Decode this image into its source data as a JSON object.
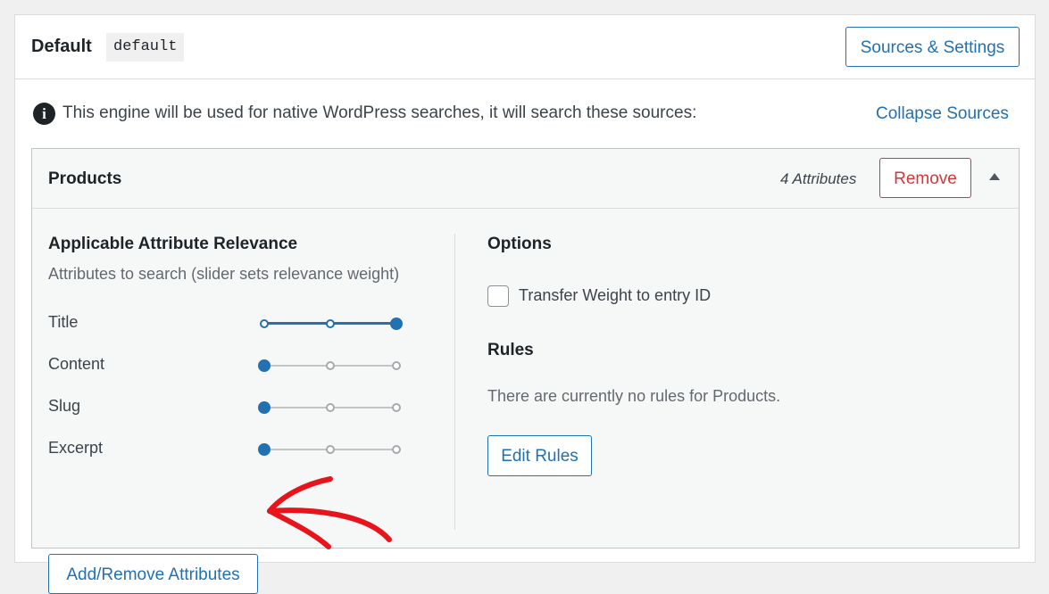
{
  "engine": {
    "title": "Default",
    "slug": "default",
    "sources_button": "Sources & Settings",
    "info_text": "This engine will be used for native WordPress searches, it will search these sources:",
    "collapse_link": "Collapse Sources"
  },
  "source": {
    "title": "Products",
    "attribute_count": "4 Attributes",
    "remove_button": "Remove",
    "relevance": {
      "heading": "Applicable Attribute Relevance",
      "subheading": "Attributes to search (slider sets relevance weight)",
      "attributes": [
        {
          "label": "Title",
          "weight": 3
        },
        {
          "label": "Content",
          "weight": 1
        },
        {
          "label": "Slug",
          "weight": 1
        },
        {
          "label": "Excerpt",
          "weight": 1
        }
      ],
      "weight_max": 3,
      "add_remove_button": "Add/Remove Attributes"
    },
    "options": {
      "heading": "Options",
      "transfer_weight_label": "Transfer Weight to entry ID",
      "transfer_weight_checked": false
    },
    "rules": {
      "heading": "Rules",
      "empty_text": "There are currently no rules for Products.",
      "edit_button": "Edit Rules"
    }
  },
  "colors": {
    "accent": "#2271b1",
    "danger": "#d63638",
    "annotation_arrow": "#e8141b"
  }
}
